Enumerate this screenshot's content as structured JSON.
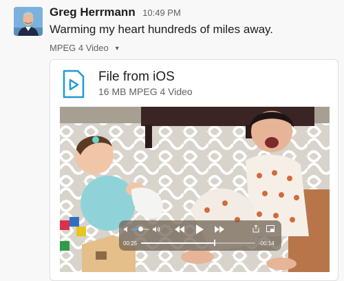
{
  "message": {
    "sender": "Greg Herrmann",
    "time": "10:49 PM",
    "text": "Warming my heart hundreds of miles away."
  },
  "attachment": {
    "toggle_label": "MPEG 4 Video",
    "file_name": "File from iOS",
    "file_meta": "16 MB MPEG 4 Video",
    "icon": "video-file-icon",
    "accent_color": "#1d9bd1"
  },
  "player": {
    "current_time": "00:25",
    "remaining_time": "-00:14",
    "volume_level": 0.5,
    "progress": 0.64
  }
}
